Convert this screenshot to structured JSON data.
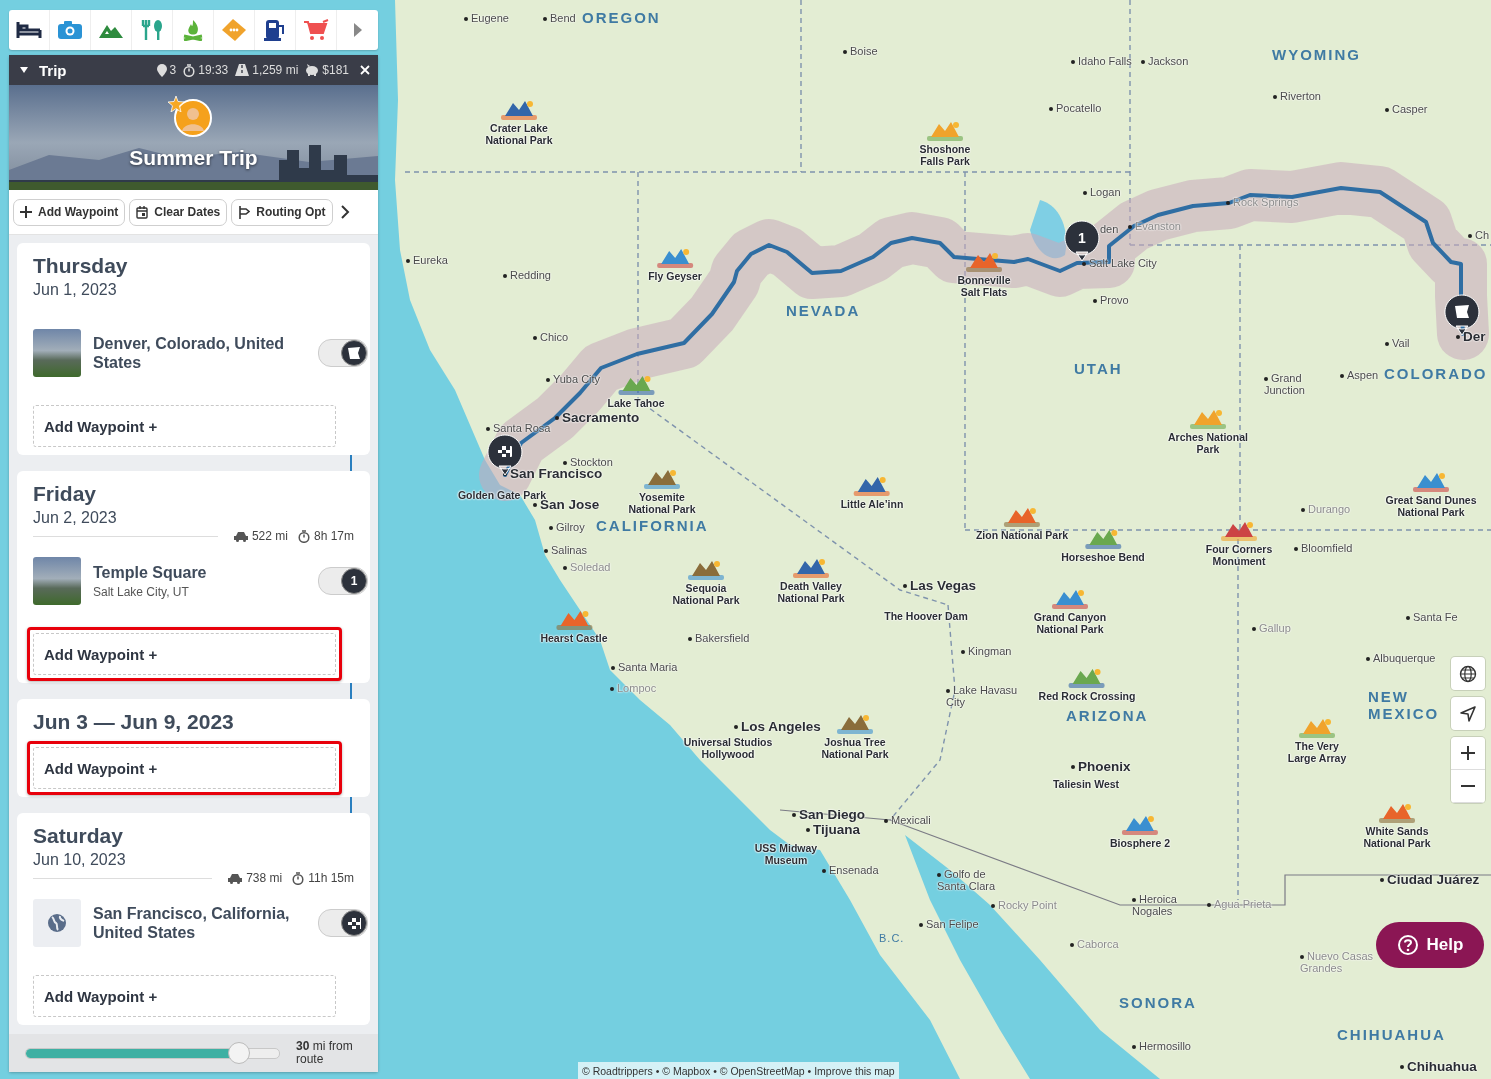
{
  "trip_header": {
    "expanded": true,
    "title": "Trip",
    "stops": "3",
    "duration": "19:33",
    "distance": "1,259 mi",
    "cost": "$181"
  },
  "cover": {
    "title": "Summer Trip"
  },
  "actions": [
    {
      "kind": "add",
      "label": "Add Waypoint"
    },
    {
      "kind": "dates",
      "label": "Clear Dates"
    },
    {
      "kind": "routing",
      "label": "Routing Opt"
    }
  ],
  "days": [
    {
      "title": "Thursday",
      "date": "Jun 1, 2023",
      "stops": [
        {
          "kind": "start",
          "name": "Denver, Colorado, United States",
          "on": true
        }
      ],
      "add_label": "Add Waypoint +",
      "highlighted": false
    },
    {
      "title": "Friday",
      "date": "Jun 2, 2023",
      "distance": "522 mi",
      "duration": "8h 17m",
      "stops": [
        {
          "kind": "waypoint",
          "name": "Temple Square",
          "subtitle": "Salt Lake City, UT",
          "number": "1",
          "on": true
        }
      ],
      "add_label": "Add Waypoint +",
      "highlighted": true
    },
    {
      "title": "Jun 3 — Jun 9, 2023",
      "add_label": "Add Waypoint +",
      "highlighted": true
    },
    {
      "title": "Saturday",
      "date": "Jun 10, 2023",
      "distance": "738 mi",
      "duration": "11h 15m",
      "stops": [
        {
          "kind": "finish",
          "name": "San Francisco, California, United States",
          "on": true
        }
      ],
      "add_label": "Add Waypoint +",
      "highlighted": false
    }
  ],
  "radius": {
    "level": 0.84,
    "text": "**30** mi from route"
  },
  "map": {
    "labels": [
      {
        "kind": "state",
        "text": "OREGON"
      },
      {
        "kind": "state",
        "text": "WYOMING"
      },
      {
        "kind": "state",
        "text": "NEVADA"
      },
      {
        "kind": "state",
        "text": "UTAH"
      },
      {
        "kind": "state",
        "text": "COLORADO"
      },
      {
        "kind": "state",
        "text": "CALIFORNIA"
      },
      {
        "kind": "state",
        "text": "ARIZONA"
      },
      {
        "kind": "state",
        "text": "NEW MEXICO"
      },
      {
        "kind": "region",
        "text": "B.C."
      },
      {
        "kind": "state",
        "text": "SONORA"
      },
      {
        "kind": "state",
        "text": "CHIHUAHUA"
      },
      {
        "kind": "city",
        "text": "Eugene"
      },
      {
        "kind": "city",
        "text": "Bend"
      },
      {
        "kind": "city",
        "text": "Boise"
      },
      {
        "kind": "city",
        "text": "Idaho Falls"
      },
      {
        "kind": "city",
        "text": "Jackson"
      },
      {
        "kind": "city",
        "text": "Riverton"
      },
      {
        "kind": "city",
        "text": "Casper"
      },
      {
        "kind": "city",
        "text": "Pocatello"
      },
      {
        "kind": "city",
        "text": "Logan"
      },
      {
        "kind": "city",
        "text": "Eureka"
      },
      {
        "kind": "city",
        "text": "Redding"
      },
      {
        "kind": "city",
        "text": "Chico"
      },
      {
        "kind": "city",
        "text": "Yuba City"
      },
      {
        "kind": "city",
        "text": "Santa Rosa"
      },
      {
        "kind": "city",
        "text": "Stockton"
      },
      {
        "kind": "city",
        "text": "Gilroy"
      },
      {
        "kind": "city",
        "text": "Salinas"
      },
      {
        "kind": "minor",
        "text": "Soledad"
      },
      {
        "kind": "partial",
        "text": "den"
      },
      {
        "kind": "city",
        "text": "Salt Lake City"
      },
      {
        "kind": "minor",
        "text": "Evanston"
      },
      {
        "kind": "minor",
        "text": "Rock Springs"
      },
      {
        "kind": "city",
        "text": "Provo"
      },
      {
        "kind": "city",
        "text": "Ch"
      },
      {
        "kind": "city",
        "text": "Vail"
      },
      {
        "kind": "city",
        "text": "Grand Junction"
      },
      {
        "kind": "city",
        "text": "Aspen"
      },
      {
        "kind": "minor",
        "text": "Durango"
      },
      {
        "kind": "city",
        "text": "Bloomfield"
      },
      {
        "kind": "minor",
        "text": "Gallup"
      },
      {
        "kind": "city",
        "text": "Santa Fe"
      },
      {
        "kind": "city",
        "text": "Albuquerque"
      },
      {
        "kind": "city",
        "text": "Kingman"
      },
      {
        "kind": "city",
        "text": "Lake Havasu City"
      },
      {
        "kind": "city",
        "text": "Bakersfield"
      },
      {
        "kind": "city",
        "text": "Santa Maria"
      },
      {
        "kind": "minor",
        "text": "Lompoc"
      },
      {
        "kind": "city",
        "text": "Mexicali"
      },
      {
        "kind": "city",
        "text": "Ensenada"
      },
      {
        "kind": "city",
        "text": "Golfo de Santa Clara"
      },
      {
        "kind": "minor",
        "text": "Rocky Point"
      },
      {
        "kind": "city",
        "text": "San Felipe"
      },
      {
        "kind": "minor",
        "text": "Caborca"
      },
      {
        "kind": "city",
        "text": "Heroica Nogales"
      },
      {
        "kind": "minor",
        "text": "Agua Prieta"
      },
      {
        "kind": "minor",
        "text": "Nuevo Casas Grandes"
      },
      {
        "kind": "city",
        "text": "Hermosillo"
      },
      {
        "kind": "major",
        "text": "Sacramento"
      },
      {
        "kind": "major",
        "text": "San Francisco"
      },
      {
        "kind": "major",
        "text": "San Jose"
      },
      {
        "kind": "major",
        "text": "Las Vegas"
      },
      {
        "kind": "major",
        "text": "Los Angeles"
      },
      {
        "kind": "major",
        "text": "San Diego"
      },
      {
        "kind": "major",
        "text": "Tijuana"
      },
      {
        "kind": "major",
        "text": "Phoenix"
      },
      {
        "kind": "major",
        "text": "Ciudad Juárez"
      },
      {
        "kind": "major",
        "text": "Chihuahua"
      },
      {
        "kind": "major",
        "text": "Der"
      },
      {
        "kind": "poi",
        "text": "Crater Lake National Park"
      },
      {
        "kind": "poi",
        "text": "Shoshone Falls Park"
      },
      {
        "kind": "poi",
        "text": "Fly Geyser"
      },
      {
        "kind": "poi",
        "text": "Bonneville Salt Flats"
      },
      {
        "kind": "poi",
        "text": "Lake Tahoe"
      },
      {
        "kind": "poi",
        "text": "Golden Gate Park"
      },
      {
        "kind": "poi",
        "text": "Yosemite National Park"
      },
      {
        "kind": "poi",
        "text": "Little Ale’inn"
      },
      {
        "kind": "poi",
        "text": "Arches National Park"
      },
      {
        "kind": "poi",
        "text": "Great Sand Dunes National Park"
      },
      {
        "kind": "poi",
        "text": "Zion National Park"
      },
      {
        "kind": "poi",
        "text": "Horseshoe Bend"
      },
      {
        "kind": "poi",
        "text": "Four Corners Monument"
      },
      {
        "kind": "poi",
        "text": "Sequoia National Park"
      },
      {
        "kind": "poi",
        "text": "Death Valley National Park"
      },
      {
        "kind": "poi",
        "text": "The Hoover Dam"
      },
      {
        "kind": "poi",
        "text": "Grand Canyon National Park"
      },
      {
        "kind": "poi",
        "text": "Hearst Castle"
      },
      {
        "kind": "poi",
        "text": "Red Rock Crossing"
      },
      {
        "kind": "poi",
        "text": "Universal Studios Hollywood"
      },
      {
        "kind": "poi",
        "text": "Joshua Tree National Park"
      },
      {
        "kind": "poi",
        "text": "Taliesin West"
      },
      {
        "kind": "poi",
        "text": "The Very Large Array"
      },
      {
        "kind": "poi",
        "text": "Biosphere 2"
      },
      {
        "kind": "poi",
        "text": "White Sands National Park"
      },
      {
        "kind": "poi",
        "text": "USS Midway Museum"
      }
    ],
    "markers": [
      {
        "kind": "finish"
      },
      {
        "kind": "number",
        "text": "1"
      },
      {
        "kind": "start"
      }
    ],
    "help": "Help",
    "attribution": "© Roadtrippers • © Mapbox • © OpenStreetMap •",
    "attribution_link": "Improve this map"
  }
}
